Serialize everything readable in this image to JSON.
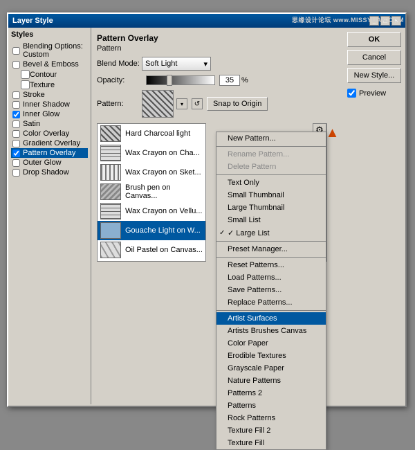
{
  "dialog": {
    "title": "Layer Style",
    "watermark": "思缘设计论坛  www.MISSYUAN.COM"
  },
  "left_panel": {
    "title": "Styles",
    "items": [
      {
        "label": "Blending Options: Custom",
        "checked": false,
        "active": false,
        "indent": 0
      },
      {
        "label": "Bevel & Emboss",
        "checked": false,
        "active": false,
        "indent": 0
      },
      {
        "label": "Contour",
        "checked": false,
        "active": false,
        "indent": 1
      },
      {
        "label": "Texture",
        "checked": false,
        "active": false,
        "indent": 1
      },
      {
        "label": "Stroke",
        "checked": false,
        "active": false,
        "indent": 0
      },
      {
        "label": "Inner Shadow",
        "checked": false,
        "active": false,
        "indent": 0
      },
      {
        "label": "Inner Glow",
        "checked": true,
        "active": false,
        "indent": 0
      },
      {
        "label": "Satin",
        "checked": false,
        "active": false,
        "indent": 0
      },
      {
        "label": "Color Overlay",
        "checked": false,
        "active": false,
        "indent": 0
      },
      {
        "label": "Gradient Overlay",
        "checked": false,
        "active": false,
        "indent": 0
      },
      {
        "label": "Pattern Overlay",
        "checked": true,
        "active": true,
        "indent": 0
      },
      {
        "label": "Outer Glow",
        "checked": false,
        "active": false,
        "indent": 0
      },
      {
        "label": "Drop Shadow",
        "checked": false,
        "active": false,
        "indent": 0
      }
    ]
  },
  "pattern_overlay": {
    "section_title": "Pattern Overlay",
    "section_sub": "Pattern",
    "blend_mode_label": "Blend Mode:",
    "blend_mode_value": "Soft Light",
    "opacity_label": "Opacity:",
    "opacity_value": "35",
    "opacity_unit": "%",
    "pattern_label": "Pattern:",
    "snap_btn": "Snap to Origin"
  },
  "pattern_list": {
    "items": [
      {
        "label": "Hard Charcoal light",
        "thumb": "1",
        "selected": false
      },
      {
        "label": "Wax Crayon on Cha...",
        "thumb": "2",
        "selected": false
      },
      {
        "label": "Wax Crayon on Sket...",
        "thumb": "3",
        "selected": false
      },
      {
        "label": "Brush pen on Canvas...",
        "thumb": "4",
        "selected": false
      },
      {
        "label": "Wax Crayon on Vellu...",
        "thumb": "2",
        "selected": false
      },
      {
        "label": "Gouache Light on W...",
        "thumb": "5",
        "selected": true
      },
      {
        "label": "Oil Pastel on Canvas...",
        "thumb": "6",
        "selected": false
      }
    ]
  },
  "right_buttons": {
    "ok": "OK",
    "cancel": "Cancel",
    "new_style": "New Style...",
    "preview_label": "Preview",
    "preview_checked": true
  },
  "context_menu": {
    "items": [
      {
        "label": "New Pattern...",
        "type": "normal"
      },
      {
        "label": "",
        "type": "separator"
      },
      {
        "label": "Rename Pattern...",
        "type": "disabled"
      },
      {
        "label": "Delete Pattern",
        "type": "disabled"
      },
      {
        "label": "",
        "type": "separator"
      },
      {
        "label": "Text Only",
        "type": "normal"
      },
      {
        "label": "Small Thumbnail",
        "type": "normal"
      },
      {
        "label": "Large Thumbnail",
        "type": "normal"
      },
      {
        "label": "Small List",
        "type": "normal"
      },
      {
        "label": "Large List",
        "type": "checked"
      },
      {
        "label": "",
        "type": "separator"
      },
      {
        "label": "Preset Manager...",
        "type": "normal"
      },
      {
        "label": "",
        "type": "separator"
      },
      {
        "label": "Reset Patterns...",
        "type": "normal"
      },
      {
        "label": "Load Patterns...",
        "type": "normal"
      },
      {
        "label": "Save Patterns...",
        "type": "normal"
      },
      {
        "label": "Replace Patterns...",
        "type": "normal"
      },
      {
        "label": "",
        "type": "separator"
      },
      {
        "label": "Artist Surfaces",
        "type": "highlighted"
      },
      {
        "label": "Artists Brushes Canvas",
        "type": "normal"
      },
      {
        "label": "Color Paper",
        "type": "normal"
      },
      {
        "label": "Erodible Textures",
        "type": "normal"
      },
      {
        "label": "Grayscale Paper",
        "type": "normal"
      },
      {
        "label": "Nature Patterns",
        "type": "normal"
      },
      {
        "label": "Patterns 2",
        "type": "normal"
      },
      {
        "label": "Patterns",
        "type": "normal"
      },
      {
        "label": "Rock Patterns",
        "type": "normal"
      },
      {
        "label": "Texture Fill 2",
        "type": "normal"
      },
      {
        "label": "Texture Fill",
        "type": "normal"
      }
    ]
  }
}
